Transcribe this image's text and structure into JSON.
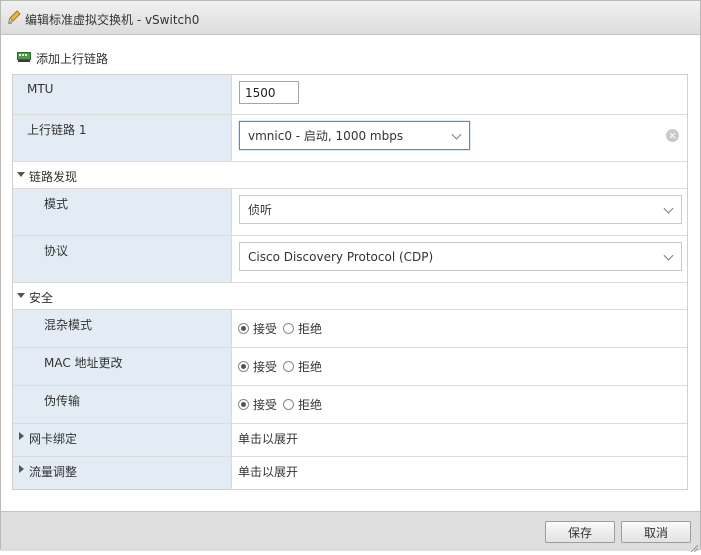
{
  "dialog": {
    "title": "编辑标准虚拟交换机 - vSwitch0"
  },
  "toolbar": {
    "add_uplink_label": "添加上行链路"
  },
  "form": {
    "mtu": {
      "label": "MTU",
      "value": "1500"
    },
    "uplink1": {
      "label": "上行链路 1",
      "value": "vmnic0 - 启动, 1000 mbps"
    },
    "link_discovery": {
      "label": "链路发现",
      "mode": {
        "label": "模式",
        "value": "侦听"
      },
      "protocol": {
        "label": "协议",
        "value": "Cisco Discovery Protocol (CDP)"
      }
    },
    "security": {
      "label": "安全",
      "promiscuous": {
        "label": "混杂模式",
        "selected": "接受"
      },
      "mac_changes": {
        "label": "MAC 地址更改",
        "selected": "接受"
      },
      "forged_transmits": {
        "label": "伪传输",
        "selected": "接受"
      },
      "accept_label": "接受",
      "reject_label": "拒绝"
    },
    "nic_teaming": {
      "label": "网卡绑定",
      "value": "单击以展开"
    },
    "traffic_shaping": {
      "label": "流量调整",
      "value": "单击以展开"
    }
  },
  "footer": {
    "save_label": "保存",
    "cancel_label": "取消"
  },
  "colors": {
    "label_column_bg": "#e3ecf4",
    "focus_border": "#4a90d9"
  }
}
